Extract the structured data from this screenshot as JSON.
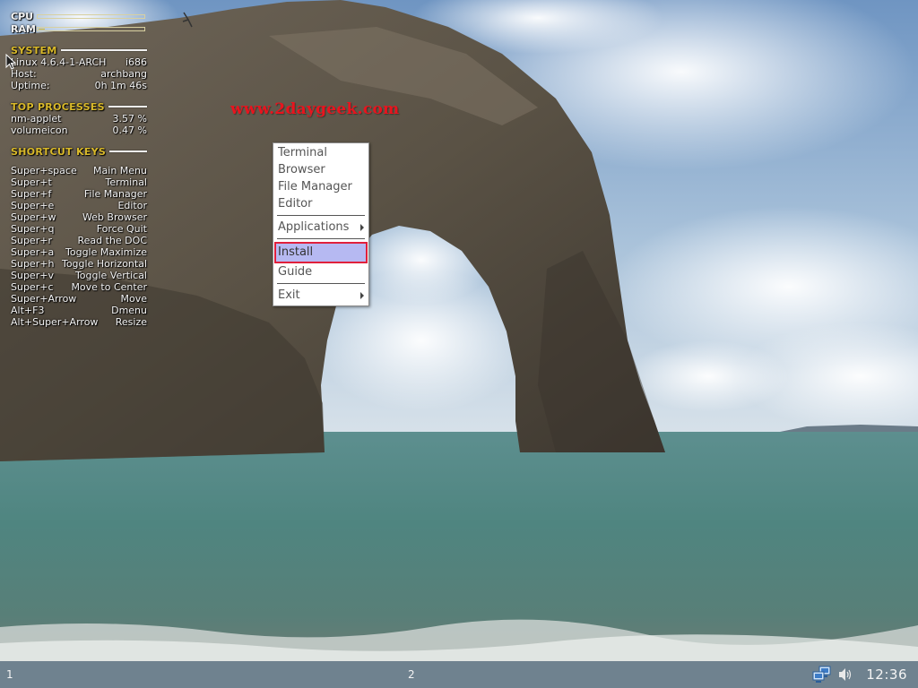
{
  "watermark": "www.2daygeek.com",
  "conky": {
    "cpu_label": "CPU",
    "ram_label": "RAM",
    "cpu_usage_fraction": 0.0,
    "ram_usage_fraction": 0.06,
    "system": {
      "title": "SYSTEM",
      "kernel": "Linux 4.6.4-1-ARCH",
      "arch": "i686",
      "host_label": "Host:",
      "host": "archbang",
      "uptime_label": "Uptime:",
      "uptime": "0h 1m 46s"
    },
    "top_processes": {
      "title": "TOP PROCESSES",
      "items": [
        {
          "name": "nm-applet",
          "value": "3.57 %"
        },
        {
          "name": "volumeicon",
          "value": "0.47 %"
        }
      ]
    },
    "shortcut_keys": {
      "title": "SHORTCUT KEYS",
      "items": [
        {
          "key": "Super+space",
          "action": "Main Menu"
        },
        {
          "key": "Super+t",
          "action": "Terminal"
        },
        {
          "key": "Super+f",
          "action": "File Manager"
        },
        {
          "key": "Super+e",
          "action": "Editor"
        },
        {
          "key": "Super+w",
          "action": "Web Browser"
        },
        {
          "key": "Super+q",
          "action": "Force Quit"
        },
        {
          "key": "Super+r",
          "action": "Read the DOC"
        },
        {
          "key": "Super+a",
          "action": "Toggle Maximize"
        },
        {
          "key": "Super+h",
          "action": "Toggle Horizontal"
        },
        {
          "key": "Super+v",
          "action": "Toggle Vertical"
        },
        {
          "key": "Super+c",
          "action": "Move to Center"
        },
        {
          "key": "Super+Arrow",
          "action": "Move"
        },
        {
          "key": "Alt+F3",
          "action": "Dmenu"
        },
        {
          "key": "Alt+Super+Arrow",
          "action": "Resize"
        }
      ]
    },
    "accent_color": "#d9b92a"
  },
  "menu": {
    "items": [
      {
        "label": "Terminal"
      },
      {
        "label": "Browser"
      },
      {
        "label": "File Manager"
      },
      {
        "label": "Editor"
      },
      {
        "label": "Applications",
        "submenu": true
      },
      {
        "label": "Install",
        "active": true
      },
      {
        "label": "Guide"
      },
      {
        "label": "Exit",
        "submenu": true
      }
    ],
    "active_color": "#b6b9f2",
    "highlight_border_color": "#e0203c"
  },
  "taskbar": {
    "desktop_1": "1",
    "desktop_2": "2",
    "tray_icons": [
      "network-icon",
      "volume-icon"
    ],
    "clock": "12:36"
  }
}
